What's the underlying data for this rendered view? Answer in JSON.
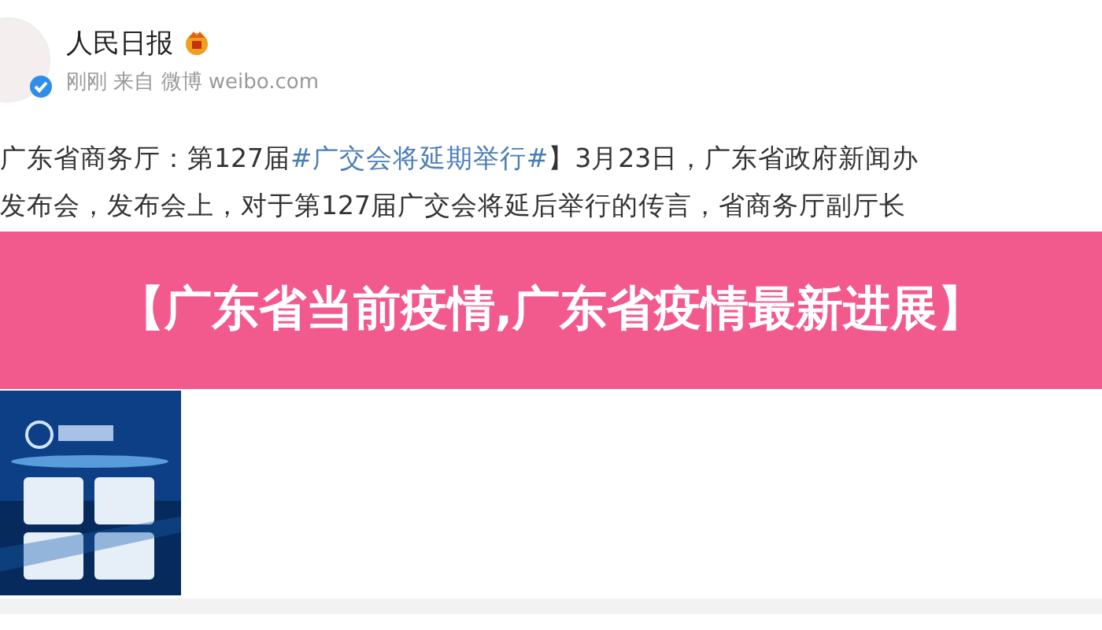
{
  "post": {
    "author": "人民日报",
    "meta": "刚刚 来自 微博 weibo.com",
    "lines": [
      {
        "segments": [
          {
            "kind": "text",
            "text": "广东省商务厅：第127届"
          },
          {
            "kind": "hashtag",
            "text": "#广交会将延期举行#"
          },
          {
            "kind": "text",
            "text": "】3月23日，广东省政府新闻办"
          }
        ]
      },
      {
        "segments": [
          {
            "kind": "text",
            "text": "发布会，发布会上，对于第127届广交会将延后举行的传言，省商务厅副厅长"
          }
        ]
      }
    ]
  },
  "banner": {
    "title": "【广东省当前疫情,广东省疫情最新进展】"
  }
}
